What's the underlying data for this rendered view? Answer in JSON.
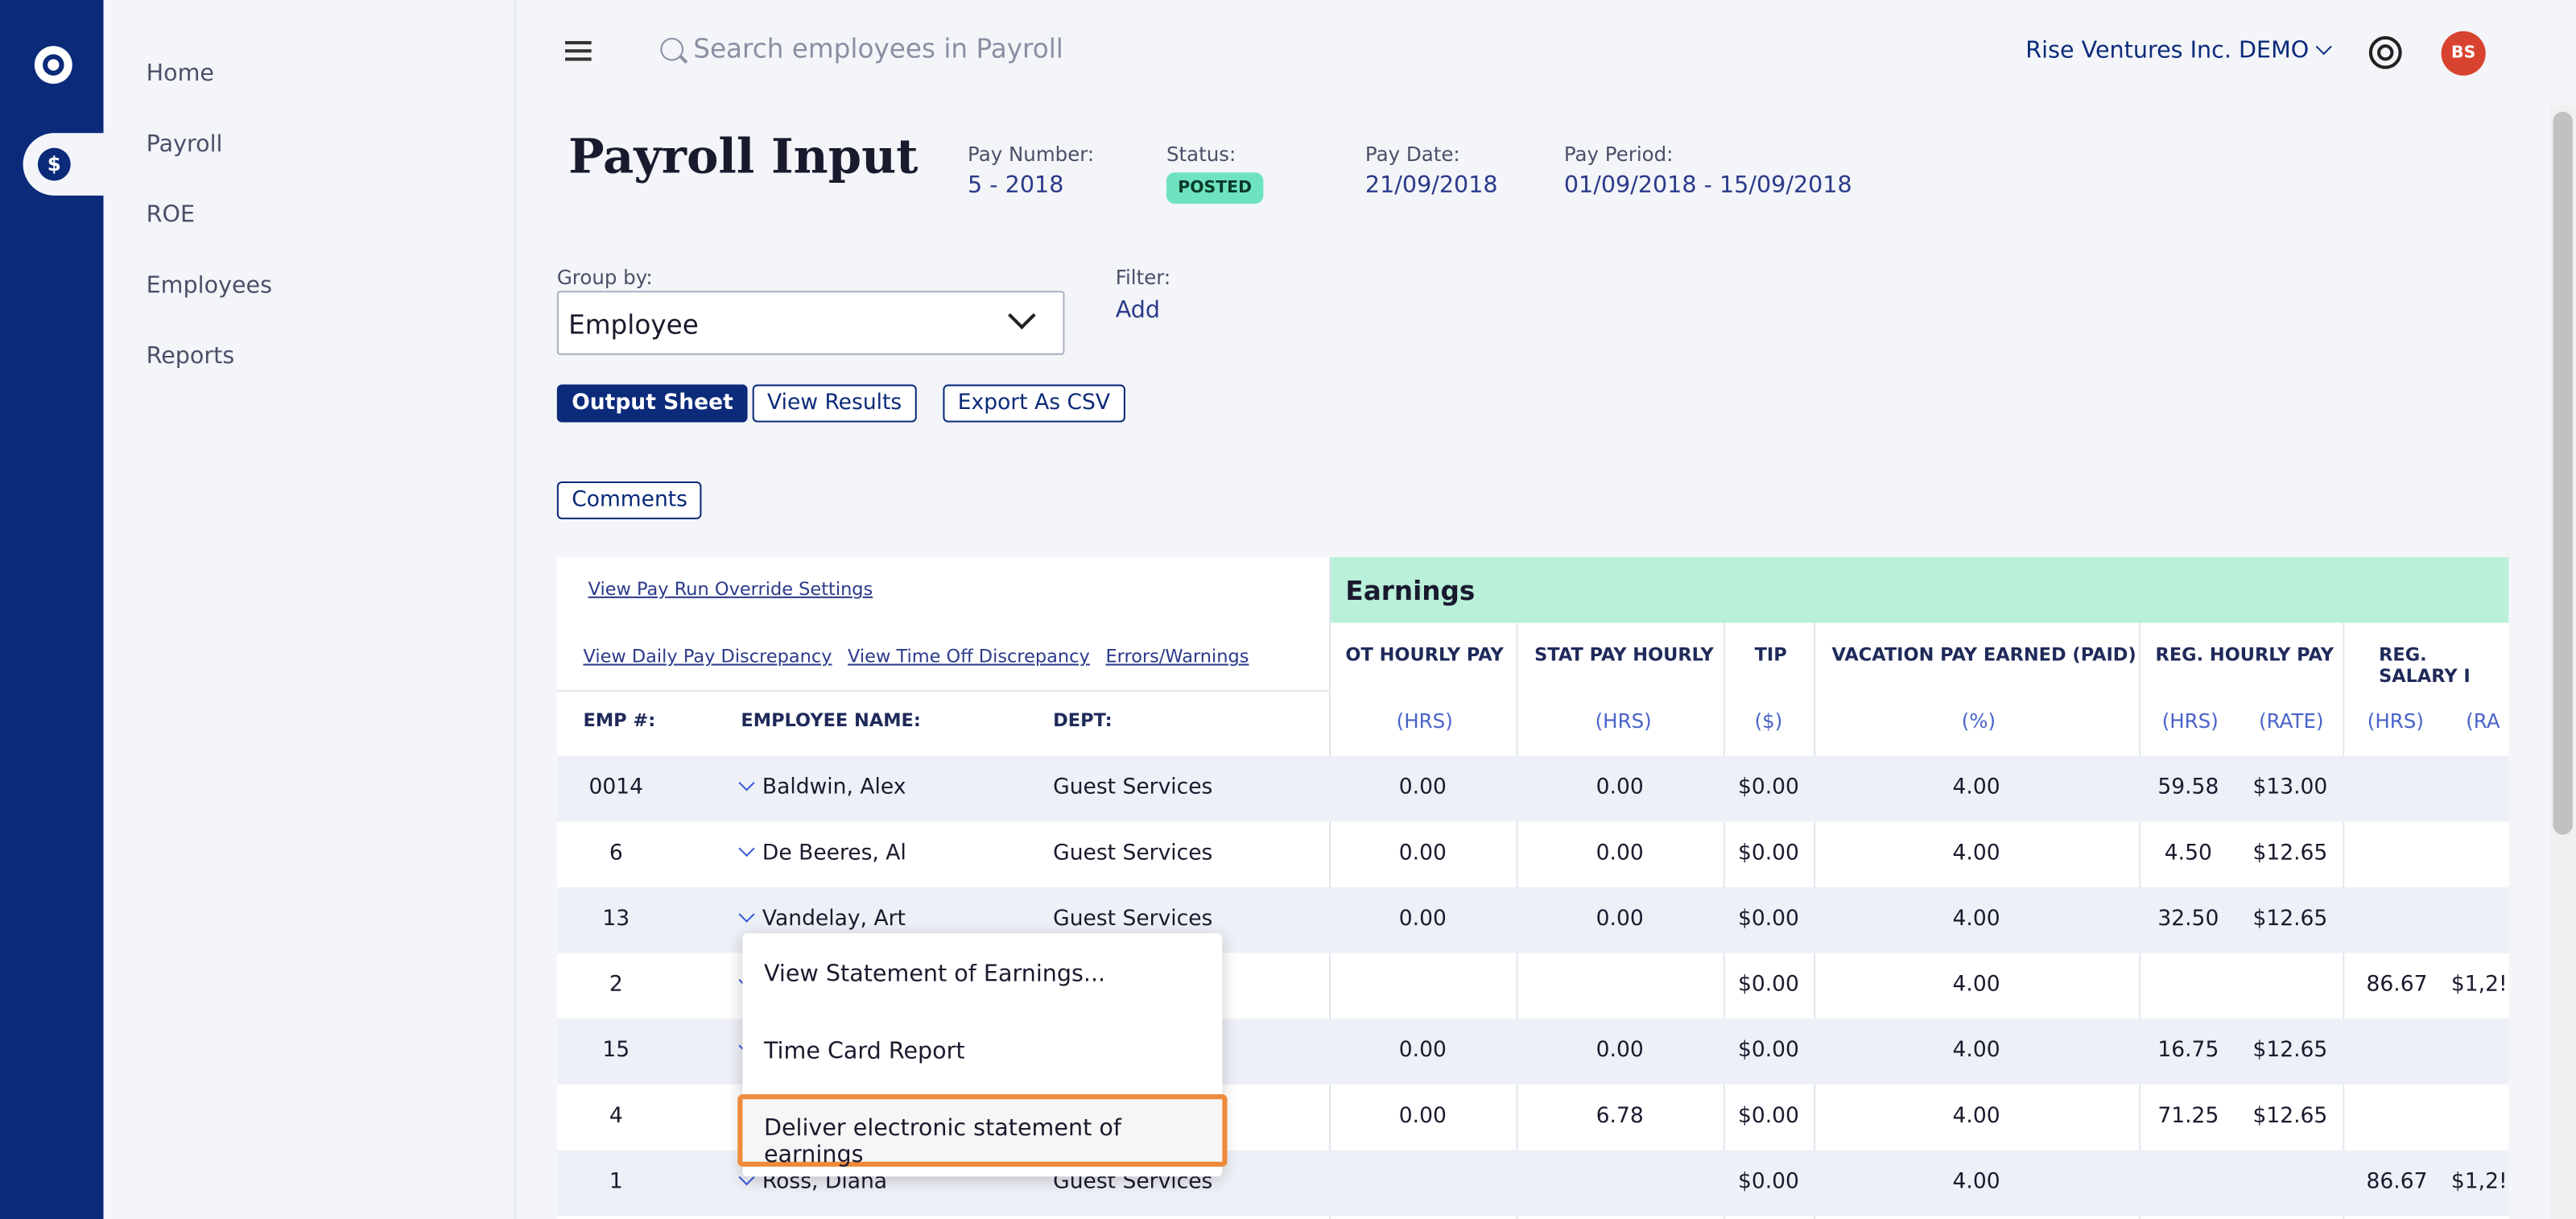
{
  "sidebar": {
    "items": [
      {
        "label": "Home"
      },
      {
        "label": "Payroll"
      },
      {
        "label": "ROE"
      },
      {
        "label": "Employees"
      },
      {
        "label": "Reports"
      }
    ]
  },
  "topbar": {
    "search_placeholder": "Search employees in Payroll",
    "company": "Rise Ventures Inc. DEMO",
    "avatar_initials": "BS"
  },
  "page": {
    "title": "Payroll Input",
    "pay_number_label": "Pay Number:",
    "pay_number": "5 - 2018",
    "status_label": "Status:",
    "status": "POSTED",
    "pay_date_label": "Pay Date:",
    "pay_date": "21/09/2018",
    "pay_period_label": "Pay Period:",
    "pay_period": "01/09/2018 - 15/09/2018"
  },
  "controls": {
    "group_by_label": "Group by:",
    "group_by_value": "Employee",
    "filter_label": "Filter:",
    "filter_add": "Add",
    "output_sheet": "Output Sheet",
    "view_results": "View Results",
    "export_csv": "Export As CSV",
    "comments": "Comments"
  },
  "table": {
    "links": {
      "override": "View Pay Run Override Settings",
      "daily": "View Daily Pay Discrepancy",
      "timeoff": "View Time Off Discrepancy",
      "errors": "Errors/Warnings"
    },
    "section": "Earnings",
    "headers": {
      "emp": "EMP #:",
      "name": "EMPLOYEE NAME:",
      "dept": "DEPT:",
      "ot": "OT HOURLY PAY",
      "stat": "STAT PAY HOURLY",
      "tip": "TIP",
      "vac": "VACATION PAY EARNED (PAID)",
      "reg_hourly": "REG. HOURLY PAY",
      "reg_salary": "REG. SALARY I"
    },
    "units": {
      "ot": "(HRS)",
      "stat": "(HRS)",
      "tip": "($)",
      "vac": "(%)",
      "reg_hrs": "(HRS)",
      "reg_rate": "(RATE)",
      "sal_hrs": "(HRS)",
      "sal_rate": "(RA"
    },
    "rows": [
      {
        "emp": "0014",
        "name": "Baldwin, Alex",
        "dept": "Guest Services",
        "ot": "0.00",
        "stat": "0.00",
        "tip": "$0.00",
        "vac": "4.00",
        "reg_hrs": "59.58",
        "reg_rate": "$13.00",
        "sal_hrs": "",
        "sal_rate": ""
      },
      {
        "emp": "6",
        "name": "De Beeres, Al",
        "dept": "Guest Services",
        "ot": "0.00",
        "stat": "0.00",
        "tip": "$0.00",
        "vac": "4.00",
        "reg_hrs": "4.50",
        "reg_rate": "$12.65",
        "sal_hrs": "",
        "sal_rate": ""
      },
      {
        "emp": "13",
        "name": "Vandelay, Art",
        "dept": "Guest Services",
        "ot": "0.00",
        "stat": "0.00",
        "tip": "$0.00",
        "vac": "4.00",
        "reg_hrs": "32.50",
        "reg_rate": "$12.65",
        "sal_hrs": "",
        "sal_rate": ""
      },
      {
        "emp": "2",
        "name": "",
        "dept": "",
        "ot": "",
        "stat": "",
        "tip": "$0.00",
        "vac": "4.00",
        "reg_hrs": "",
        "reg_rate": "",
        "sal_hrs": "86.67",
        "sal_rate": "$1,2!"
      },
      {
        "emp": "15",
        "name": "",
        "dept": "",
        "ot": "0.00",
        "stat": "0.00",
        "tip": "$0.00",
        "vac": "4.00",
        "reg_hrs": "16.75",
        "reg_rate": "$12.65",
        "sal_hrs": "",
        "sal_rate": ""
      },
      {
        "emp": "4",
        "name": "",
        "dept": "",
        "ot": "0.00",
        "stat": "6.78",
        "tip": "$0.00",
        "vac": "4.00",
        "reg_hrs": "71.25",
        "reg_rate": "$12.65",
        "sal_hrs": "",
        "sal_rate": ""
      },
      {
        "emp": "1",
        "name": "Ross, Diana",
        "dept": "Guest Services",
        "ot": "",
        "stat": "",
        "tip": "$0.00",
        "vac": "4.00",
        "reg_hrs": "",
        "reg_rate": "",
        "sal_hrs": "86.67",
        "sal_rate": "$1,2!"
      }
    ]
  },
  "context_menu": {
    "items": [
      "View Statement of Earnings...",
      "Time Card Report",
      "Deliver electronic statement of earnings"
    ]
  }
}
